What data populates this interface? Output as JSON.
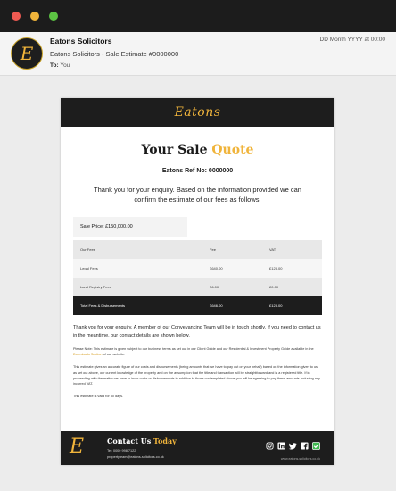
{
  "window": {
    "controls": [
      "close",
      "minimize",
      "maximize"
    ]
  },
  "email_header": {
    "sender": "Eatons Solicitors",
    "date": "DD Month YYYY at 00:00",
    "subject": "Eatons Solicitors - Sale Estimate #0000000",
    "to_label": "To:",
    "to_value": "You",
    "avatar_letter": "E"
  },
  "email": {
    "brand": "Eatons",
    "title_part1": "Your Sale ",
    "title_part2": "Quote",
    "ref": "Eatons Ref No: 0000000",
    "thanks": "Thank you for your enquiry. Based on the information provided we can confirm the estimate of our fees as follows.",
    "sale_price": "Sale Price: £150,000.00",
    "table": {
      "headers": [
        "Our Fees",
        "Fee",
        "VAT"
      ],
      "rows": [
        [
          "Legal Fees",
          "£640.00",
          "£128.00"
        ],
        [
          "Land Registry Fees",
          "£6.00",
          "£0.00"
        ]
      ],
      "total": [
        "Total Fees & Disbursements",
        "£646.00",
        "£128.00"
      ]
    },
    "paragraph1": "Thank you for your enquiry. A member of our Conveyancing Team will be in touch shortly. If you need to contact us in the meantime, our contact details are shown below.",
    "note_pre": "Please Note: This estimate is given subject to our business terms as set out in our Client Guide and our Residential & Investment Property Guide available in the ",
    "note_link": "Downloads Section",
    "note_post": " of our website.",
    "estimate_text": "This estimate gives an accurate figure of our costs and disbursements (being amounts that we have to pay out on your behalf) based on the information given to us as set out above, our current knowledge of the property and on the assumption that the title and transaction will be straightforward and is a registered title. If in proceeding with the matter we have to incur costs or disbursements in addition to those contemplated above you will be agreeing to pay these amounts including any incurred VAT.",
    "valid_text": "This estimate is valid for 30 days.",
    "footer": {
      "logo_letter": "E",
      "contact_part1": "Contact Us ",
      "contact_part2": "Today",
      "tel": "Tel: 0000 998 7122",
      "email": "propertyteam@eatons-solicitors.co.uk",
      "website": "www.eatons-solicitors.co.uk",
      "socials": [
        "instagram-icon",
        "linkedin-icon",
        "twitter-icon",
        "facebook-icon",
        "checkbox-icon"
      ]
    }
  },
  "colors": {
    "accent": "#f0b43b",
    "dark": "#1d1d1d",
    "check_green": "#3fb950"
  }
}
